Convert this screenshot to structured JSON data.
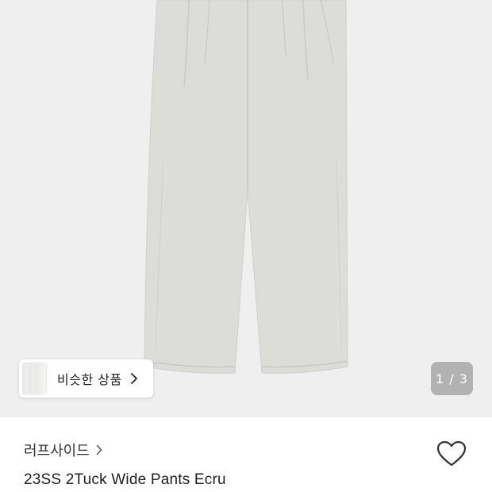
{
  "gallery": {
    "similar_products_label": "비슷한 상품",
    "page_indicator": "1 / 3",
    "icons": {
      "similar_chevron": "chevron-right-icon"
    }
  },
  "product": {
    "brand": "러프사이드",
    "name": "23SS 2Tuck Wide Pants Ecru",
    "icons": {
      "brand_chevron": "chevron-right-icon",
      "wishlist": "heart-outline-icon"
    }
  },
  "colors": {
    "gallery_background": "#efefef",
    "product_color": "#dcdcd8",
    "indicator_background": "#8a8a8a",
    "text_primary": "#1f1f1f"
  }
}
